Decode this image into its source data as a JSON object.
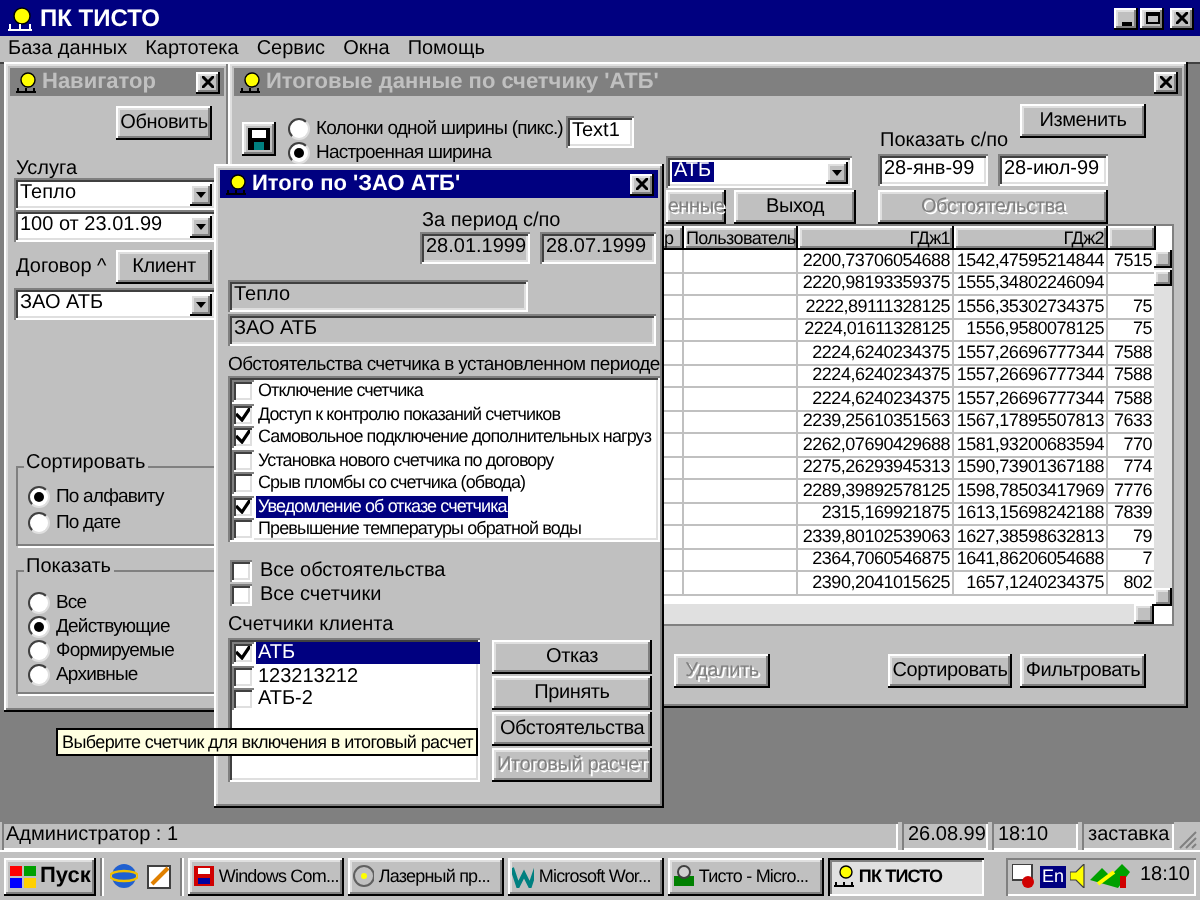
{
  "app": {
    "title": "ПК ТИСТО"
  },
  "menu": [
    "База данных",
    "Картотека",
    "Сервис",
    "Окна",
    "Помощь"
  ],
  "navigator": {
    "title": "Навигатор",
    "active": false,
    "refresh_button": "Обновить",
    "service_label": "Услуга",
    "service": "Тепло",
    "contract": "100 от 23.01.99",
    "contract_label": "Договор ^",
    "client_button": "Клиент",
    "client": "ЗАО АТБ",
    "sort": {
      "label": "Сортировать",
      "options": [
        {
          "label": "По алфавиту",
          "selected": true
        },
        {
          "label": "По дате",
          "selected": false
        }
      ]
    },
    "show": {
      "label": "Показать",
      "options": [
        {
          "label": "Все",
          "selected": false
        },
        {
          "label": "Действующие",
          "selected": true
        },
        {
          "label": "Формируемые",
          "selected": false
        },
        {
          "label": "Архивные",
          "selected": false
        }
      ]
    }
  },
  "totals_window": {
    "title": "Итоговые данные по счетчику 'АТБ'",
    "active": false,
    "width_options": [
      {
        "label": "Колонки одной ширины (пикс.)",
        "selected": false
      },
      {
        "label": "Настроенная ширина",
        "selected": true
      }
    ],
    "width_value": "Text1",
    "change_button": "Изменить",
    "range_label": "Показать с/по",
    "meter": "АТБ",
    "date_from": "28-янв-99",
    "date_to": "28-июл-99",
    "buttons": [
      {
        "label": "енные",
        "disabled": true
      },
      {
        "label": "Выход",
        "disabled": false
      },
      {
        "label": "Обстоятельства",
        "disabled": true
      }
    ],
    "table": {
      "columns": [
        "р",
        "Пользователь",
        "ГДж1",
        "ГДж2"
      ],
      "rows": [
        {
          "gj1": "2200,73706054688",
          "gj2": "1542,47595214844",
          "column_5": "7515"
        },
        {
          "gj1": "2220,98193359375",
          "gj2": "1555,34802246094"
        },
        {
          "gj1": "2222,89111328125",
          "gj2": "1556,35302734375",
          "column_5": "75"
        },
        {
          "gj1": "2224,01611328125",
          "gj2": "1556,9580078125",
          "column_5": "75"
        },
        {
          "gj1": "2224,6240234375",
          "gj2": "1557,26696777344",
          "column_5": "7588"
        },
        {
          "gj1": "2224,6240234375",
          "gj2": "1557,26696777344",
          "column_5": "7588"
        },
        {
          "gj1": "2224,6240234375",
          "gj2": "1557,26696777344",
          "column_5": "7588"
        },
        {
          "gj1": "2239,25610351563",
          "gj2": "1567,17895507813",
          "column_5": "7633"
        },
        {
          "gj1": "2262,07690429688",
          "gj2": "1581,93200683594",
          "column_5": "770"
        },
        {
          "gj1": "2275,26293945313",
          "gj2": "1590,73901367188",
          "column_5": "774"
        },
        {
          "gj1": "2289,39892578125",
          "gj2": "1598,78503417969",
          "column_5": "7776"
        },
        {
          "gj1": "2315,169921875",
          "gj2": "1613,15698242188",
          "column_5": "7839"
        },
        {
          "gj1": "2339,80102539063",
          "gj2": "1627,38598632813",
          "column_5": "79"
        },
        {
          "gj1": "2364,7060546875",
          "gj2": "1641,86206054688",
          "column_5": "7"
        },
        {
          "gj1": "2390,2041015625",
          "gj2": "1657,1240234375",
          "column_5": "802"
        }
      ]
    },
    "bottom_buttons": [
      {
        "label": "Удалить",
        "disabled": true
      },
      {
        "label": "Сортировать",
        "disabled": false
      },
      {
        "label": "Фильтровать",
        "disabled": false
      }
    ]
  },
  "dialog": {
    "title": "Итого по 'ЗАО АТБ'",
    "active": true,
    "period_label": "За период с/по",
    "period_from": "28.01.1999",
    "period_to": "28.07.1999",
    "service": "Тепло",
    "client": "ЗАО АТБ",
    "circumstances_label": "Обстоятельства счетчика в установленном периоде",
    "circumstances": [
      {
        "label": "Отключение счетчика",
        "checked": false,
        "selected": false
      },
      {
        "label": "Доступ к контролю показаний счетчиков",
        "checked": true,
        "selected": false
      },
      {
        "label": "Самовольное подключение дополнительных нагруз",
        "checked": true,
        "selected": false
      },
      {
        "label": "Установка нового счетчика по договору",
        "checked": false,
        "selected": false
      },
      {
        "label": "Срыв пломбы со счетчика (обвода)",
        "checked": false,
        "selected": false
      },
      {
        "label": "Уведомление об отказе счетчика",
        "checked": true,
        "selected": true
      },
      {
        "label": "Превышение температуры обратной воды",
        "checked": false,
        "selected": false
      }
    ],
    "all_options": [
      {
        "label": "Все обстоятельства",
        "checked": false
      },
      {
        "label": "Все счетчики",
        "checked": false
      }
    ],
    "meters_label": "Счетчики клиента",
    "meters": [
      {
        "label": "АТБ",
        "checked": true,
        "selected": true
      },
      {
        "label": "123213212",
        "checked": false,
        "selected": false
      },
      {
        "label": "АТБ-2",
        "checked": false,
        "selected": false
      }
    ],
    "buttons": [
      {
        "label": "Отказ",
        "disabled": false
      },
      {
        "label": "Принять",
        "disabled": false
      },
      {
        "label": "Обстоятельства",
        "disabled": false
      },
      {
        "label": "Итоговый расчет",
        "disabled": true
      }
    ]
  },
  "tooltip": "Выберите счетчик для включения в итоговый расчет",
  "status_bar": {
    "user": "Администратор : 1",
    "date": "26.08.99",
    "time": "18:10",
    "screensaver": "заставка"
  },
  "taskbar": {
    "start": "Пуск",
    "tasks": [
      {
        "label": "Windows Com...",
        "selected": false
      },
      {
        "label": "Лазерный пр...",
        "selected": false
      },
      {
        "label": "Microsoft Wor...",
        "selected": false
      },
      {
        "label": "Тисто - Micro...",
        "selected": false
      },
      {
        "label": "ПК ТИСТО",
        "selected": true
      }
    ],
    "language": "En",
    "clock": "18:10"
  }
}
